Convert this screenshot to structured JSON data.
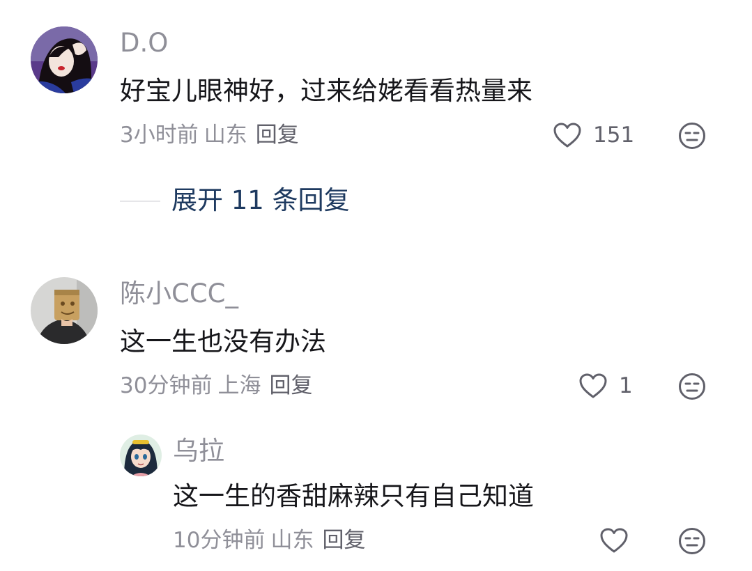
{
  "comments": [
    {
      "username": "D.O",
      "text": "好宝儿眼神好，过来给姥看看热量来",
      "time": "3小时前",
      "region": "山东",
      "reply_label": "回复",
      "likes": "151",
      "expand_label": "展开 11 条回复"
    },
    {
      "username": "陈小CCC_",
      "text": "这一生也没有办法",
      "time": "30分钟前",
      "region": "上海",
      "reply_label": "回复",
      "likes": "1",
      "replies": [
        {
          "username": "乌拉",
          "text": "这一生的香甜麻辣只有自己知道",
          "time": "10分钟前",
          "region": "山东",
          "reply_label": "回复",
          "likes": ""
        }
      ]
    }
  ],
  "colors": {
    "username": "#8f8f98",
    "text": "#16161a",
    "meta": "#8f8f98",
    "link": "#1e3a60",
    "icon": "#60606a"
  },
  "icons": {
    "like": "heart-outline-icon",
    "dislike": "neutral-face-icon"
  }
}
